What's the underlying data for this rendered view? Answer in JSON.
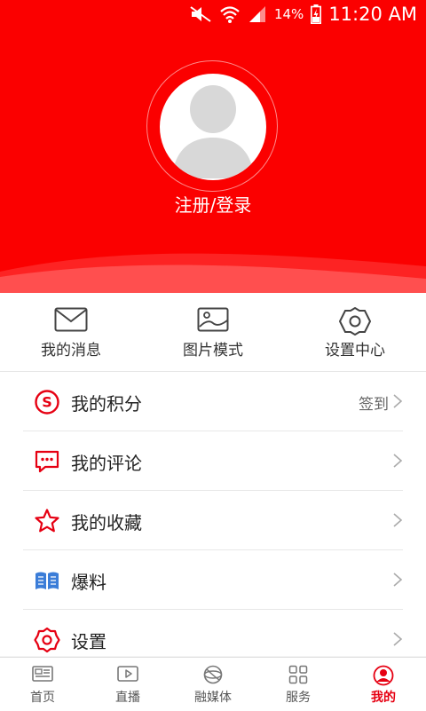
{
  "status_bar": {
    "battery_percent": "14%",
    "time": "11:20 AM"
  },
  "profile": {
    "login_label": "注册/登录"
  },
  "quick_actions": [
    {
      "label": "我的消息",
      "icon": "envelope-icon"
    },
    {
      "label": "图片模式",
      "icon": "image-icon"
    },
    {
      "label": "设置中心",
      "icon": "gear-icon"
    }
  ],
  "menu": [
    {
      "label": "我的积分",
      "icon": "points-icon",
      "extra": "签到"
    },
    {
      "label": "我的评论",
      "icon": "comment-icon",
      "extra": ""
    },
    {
      "label": "我的收藏",
      "icon": "star-icon",
      "extra": ""
    },
    {
      "label": "爆料",
      "icon": "book-icon",
      "extra": ""
    },
    {
      "label": "设置",
      "icon": "settings-icon",
      "extra": ""
    }
  ],
  "tabs": [
    {
      "label": "首页",
      "icon": "home-news-icon"
    },
    {
      "label": "直播",
      "icon": "live-play-icon"
    },
    {
      "label": "融媒体",
      "icon": "media-globe-icon"
    },
    {
      "label": "服务",
      "icon": "services-grid-icon"
    },
    {
      "label": "我的",
      "icon": "profile-icon",
      "active": true
    }
  ],
  "colors": {
    "brand_red": "#fb0000",
    "accent_red": "#e60012",
    "icon_blue": "#3b7dd8"
  }
}
